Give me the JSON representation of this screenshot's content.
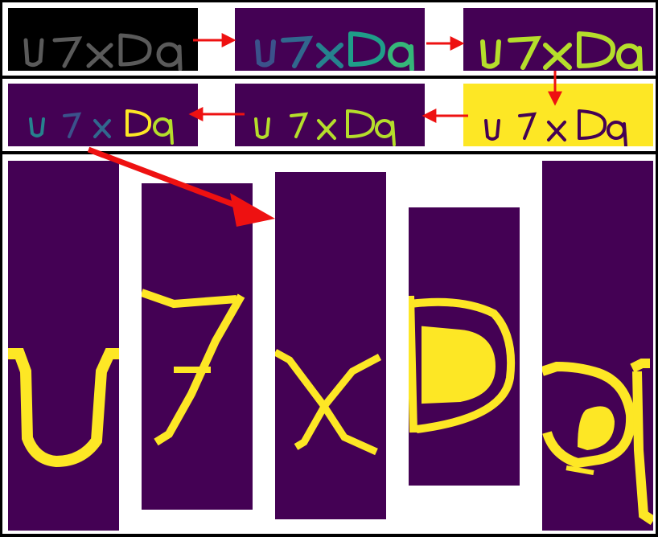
{
  "captcha_text": "u7xDq",
  "characters": [
    "u",
    "7",
    "x",
    "D",
    "q"
  ],
  "colors": {
    "black": "#000000",
    "viridis_dark": "#440154",
    "viridis_mid": "#26828e",
    "viridis_teal": "#1f9e89",
    "viridis_light": "#b5de2b",
    "viridis_yellow": "#fde725",
    "arrow_red": "#ee1111",
    "border": "#000000",
    "gray_glyph": "#555555"
  },
  "pipeline_steps": [
    {
      "stage": "grayscale"
    },
    {
      "stage": "viridis-colormap"
    },
    {
      "stage": "threshold"
    },
    {
      "stage": "inverted"
    },
    {
      "stage": "denoised"
    },
    {
      "stage": "segmented-color"
    }
  ]
}
